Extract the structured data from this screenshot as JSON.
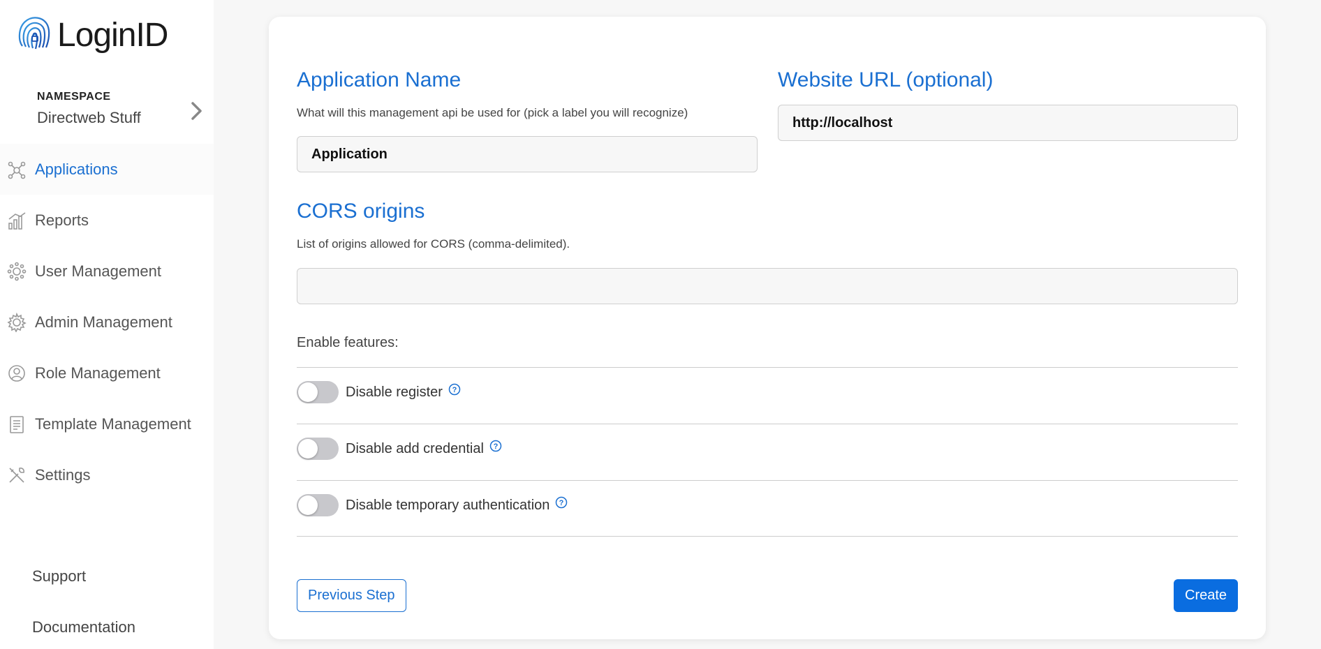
{
  "brand": {
    "name": "LoginID",
    "color": "#1a6fd1"
  },
  "namespace": {
    "label": "NAMESPACE",
    "value": "Directweb Stuff"
  },
  "nav": {
    "items": [
      {
        "label": "Applications",
        "icon": "applications-icon",
        "active": true
      },
      {
        "label": "Reports",
        "icon": "reports-icon"
      },
      {
        "label": "User Management",
        "icon": "user-management-icon"
      },
      {
        "label": "Admin Management",
        "icon": "admin-management-icon"
      },
      {
        "label": "Role Management",
        "icon": "role-management-icon"
      },
      {
        "label": "Template Management",
        "icon": "template-management-icon"
      },
      {
        "label": "Settings",
        "icon": "settings-icon"
      }
    ]
  },
  "footer_links": {
    "support": "Support",
    "documentation": "Documentation"
  },
  "form": {
    "app_name": {
      "title": "Application Name",
      "help": "What will this management api be used for (pick a label you will recognize)",
      "value": "Application"
    },
    "website_url": {
      "title": "Website URL (optional)",
      "value": "http://localhost"
    },
    "cors": {
      "title": "CORS origins",
      "help": "List of origins allowed for CORS (comma-delimited).",
      "value": ""
    },
    "features_label": "Enable features:",
    "features": [
      {
        "label": "Disable register",
        "enabled": false
      },
      {
        "label": "Disable add credential",
        "enabled": false
      },
      {
        "label": "Disable temporary authentication",
        "enabled": false
      }
    ],
    "prev_button": "Previous Step",
    "create_button": "Create"
  }
}
